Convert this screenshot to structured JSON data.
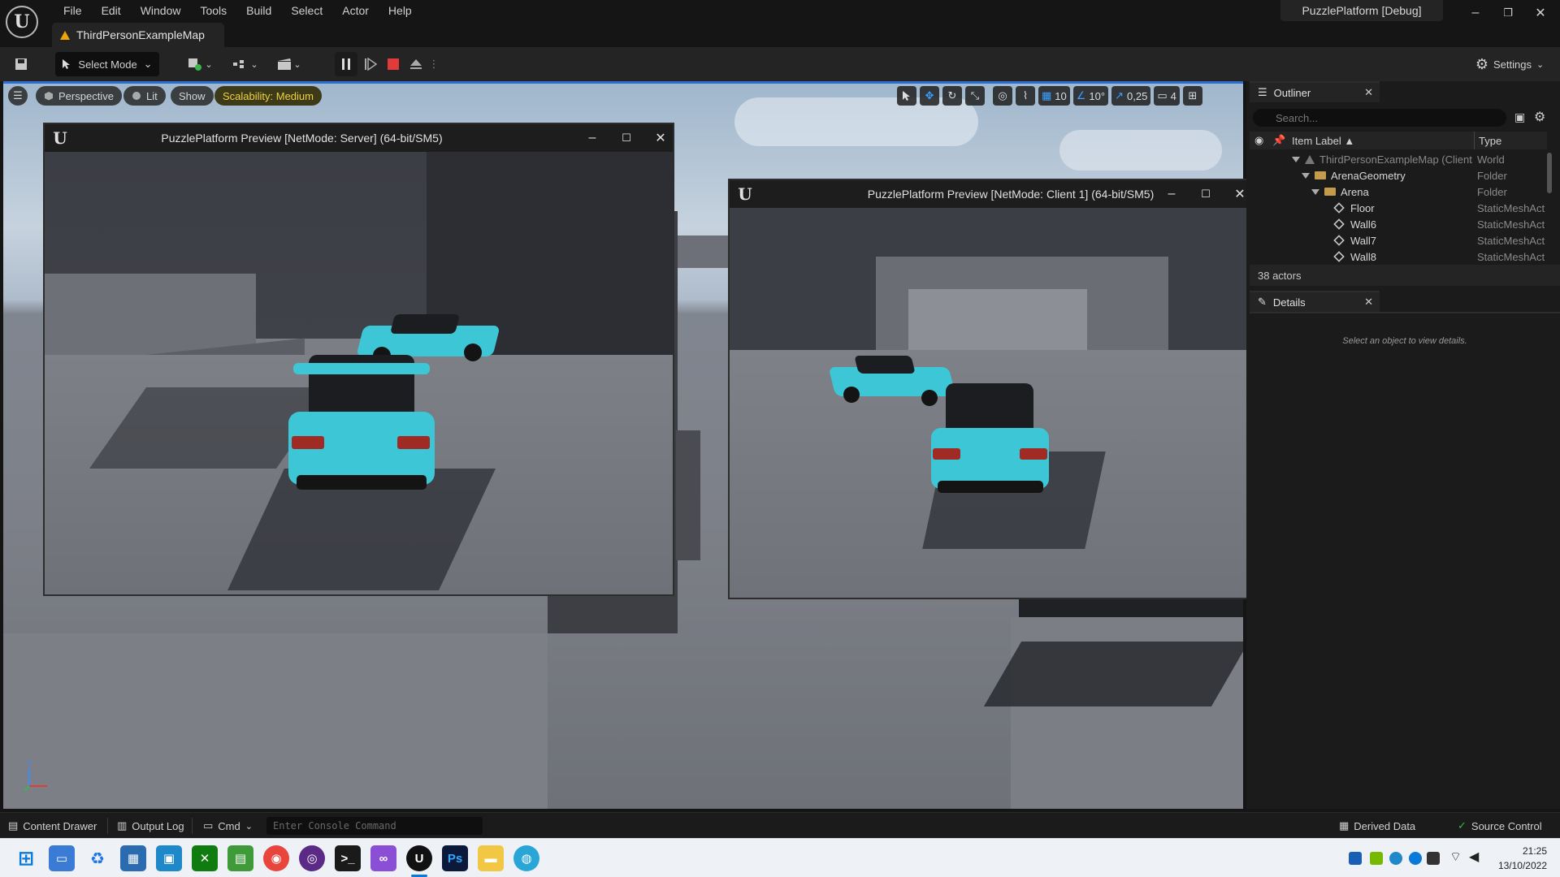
{
  "app": {
    "menu": [
      "File",
      "Edit",
      "Window",
      "Tools",
      "Build",
      "Select",
      "Actor",
      "Help"
    ],
    "map_tab": "ThirdPersonExampleMap",
    "project_title": "PuzzlePlatform [Debug]"
  },
  "toolbar": {
    "select_mode": "Select Mode",
    "settings": "Settings"
  },
  "viewport": {
    "perspective": "Perspective",
    "lit": "Lit",
    "show": "Show",
    "scalability": "Scalability: Medium",
    "grid_snap": "10",
    "rotation_snap": "10°",
    "scale_snap": "0,25",
    "camera_speed": "4",
    "axis_z": "z"
  },
  "preview_windows": [
    {
      "title": "PuzzlePlatform Preview [NetMode: Server]  (64-bit/SM5)"
    },
    {
      "title": "PuzzlePlatform Preview [NetMode: Client 1]  (64-bit/SM5)"
    }
  ],
  "outliner": {
    "tab": "Outliner",
    "search_placeholder": "Search...",
    "col_label": "Item Label ▲",
    "col_type": "Type",
    "rows": [
      {
        "label": "ThirdPersonExampleMap (Client",
        "type": "World"
      },
      {
        "label": "ArenaGeometry",
        "type": "Folder"
      },
      {
        "label": "Arena",
        "type": "Folder"
      },
      {
        "label": "Floor",
        "type": "StaticMeshAct"
      },
      {
        "label": "Wall6",
        "type": "StaticMeshAct"
      },
      {
        "label": "Wall7",
        "type": "StaticMeshAct"
      },
      {
        "label": "Wall8",
        "type": "StaticMeshAct"
      }
    ],
    "actor_count": "38 actors"
  },
  "details": {
    "tab": "Details",
    "empty_message": "Select an object to view details."
  },
  "statusbar": {
    "content_drawer": "Content Drawer",
    "output_log": "Output Log",
    "cmd": "Cmd",
    "console_placeholder": "Enter Console Command",
    "derived_data": "Derived Data",
    "source_control": "Source Control"
  },
  "taskbar": {
    "time": "21:25",
    "date": "13/10/2022"
  },
  "colors": {
    "accent_blue": "#2a6fd0",
    "car_cyan": "#3cc6d6",
    "scalability_yellow": "#f0d040"
  }
}
